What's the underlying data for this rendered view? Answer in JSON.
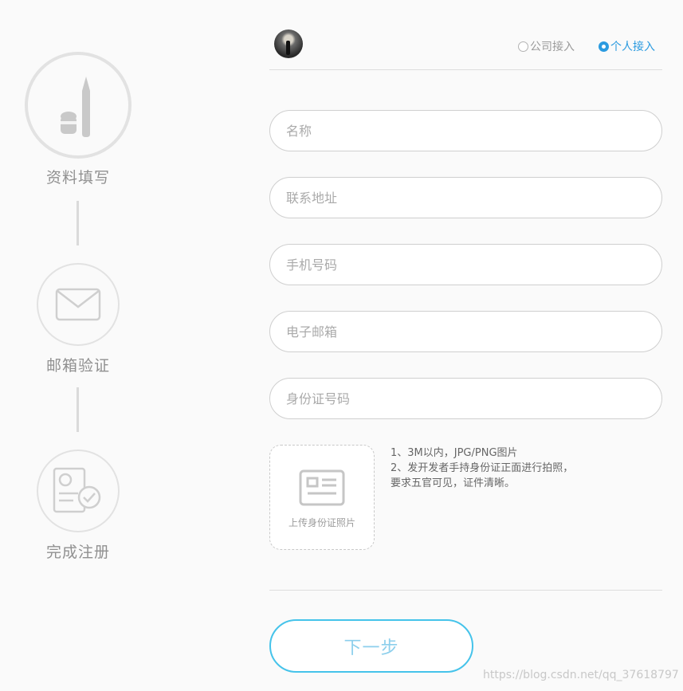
{
  "steps": [
    {
      "label": "资料填写",
      "icon": "pen-icon",
      "state": "active"
    },
    {
      "label": "邮箱验证",
      "icon": "envelope-icon",
      "state": "pending"
    },
    {
      "label": "完成注册",
      "icon": "certificate-check-icon",
      "state": "pending"
    }
  ],
  "header": {
    "avatar_icon": "user-avatar",
    "access_options": [
      {
        "label": "公司接入",
        "selected": false
      },
      {
        "label": "个人接入",
        "selected": true
      }
    ]
  },
  "form": {
    "fields": [
      {
        "placeholder": "名称",
        "value": ""
      },
      {
        "placeholder": "联系地址",
        "value": ""
      },
      {
        "placeholder": "手机号码",
        "value": ""
      },
      {
        "placeholder": "电子邮箱",
        "value": ""
      },
      {
        "placeholder": "身份证号码",
        "value": ""
      }
    ],
    "upload": {
      "icon": "id-card-icon",
      "label": "上传身份证照片",
      "notes": [
        "1、3M以内，JPG/PNG图片",
        "2、发开发者手持身份证正面进行拍照，",
        "要求五官可见，证件清晰。"
      ]
    },
    "next_label": "下一步"
  },
  "watermark": "https://blog.csdn.net/qq_37618797",
  "colors": {
    "accent": "#2b9be0",
    "button_border": "#45c3ea",
    "step_border": "#e2e2e2",
    "page_bg": "#fafafa"
  }
}
